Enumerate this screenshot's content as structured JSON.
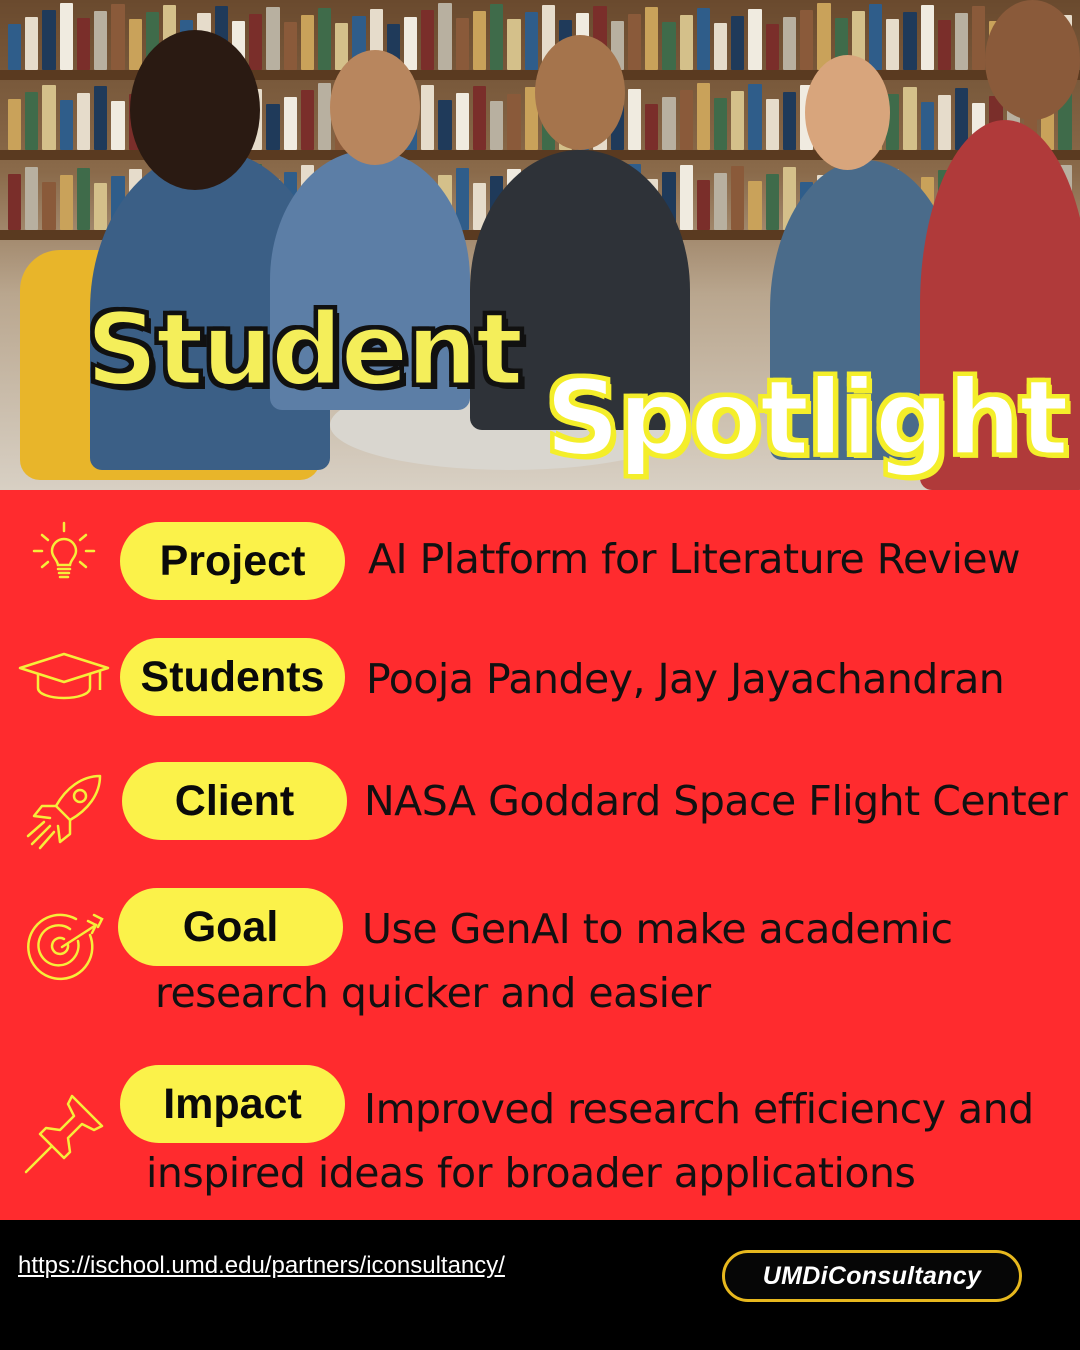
{
  "hero": {
    "title_line1": "Student",
    "title_line2": "Spotlight"
  },
  "items": [
    {
      "label": "Project",
      "value": "AI Platform for Literature Review",
      "icon": "lightbulb-icon"
    },
    {
      "label": "Students",
      "value": "Pooja Pandey, Jay Jayachandran",
      "icon": "graduation-cap-icon"
    },
    {
      "label": "Client",
      "value": "NASA Goddard Space Flight Center",
      "icon": "rocket-icon"
    },
    {
      "label": "Goal",
      "value_line1": "Use GenAI to make academic",
      "value_line2": "research quicker and easier",
      "icon": "target-icon"
    },
    {
      "label": "Impact",
      "value_line1": "Improved research efficiency and",
      "value_line2": "inspired ideas for broader applications",
      "icon": "pushpin-icon"
    }
  ],
  "footer": {
    "url": "https://ischool.umd.edu/partners/iconsultancy/",
    "brand": "UMDiConsultancy"
  },
  "colors": {
    "panel_red": "#ff2b2e",
    "pill_yellow": "#fbf24a",
    "icon_yellow": "#f7ee3a",
    "badge_border": "#e7b81e"
  }
}
